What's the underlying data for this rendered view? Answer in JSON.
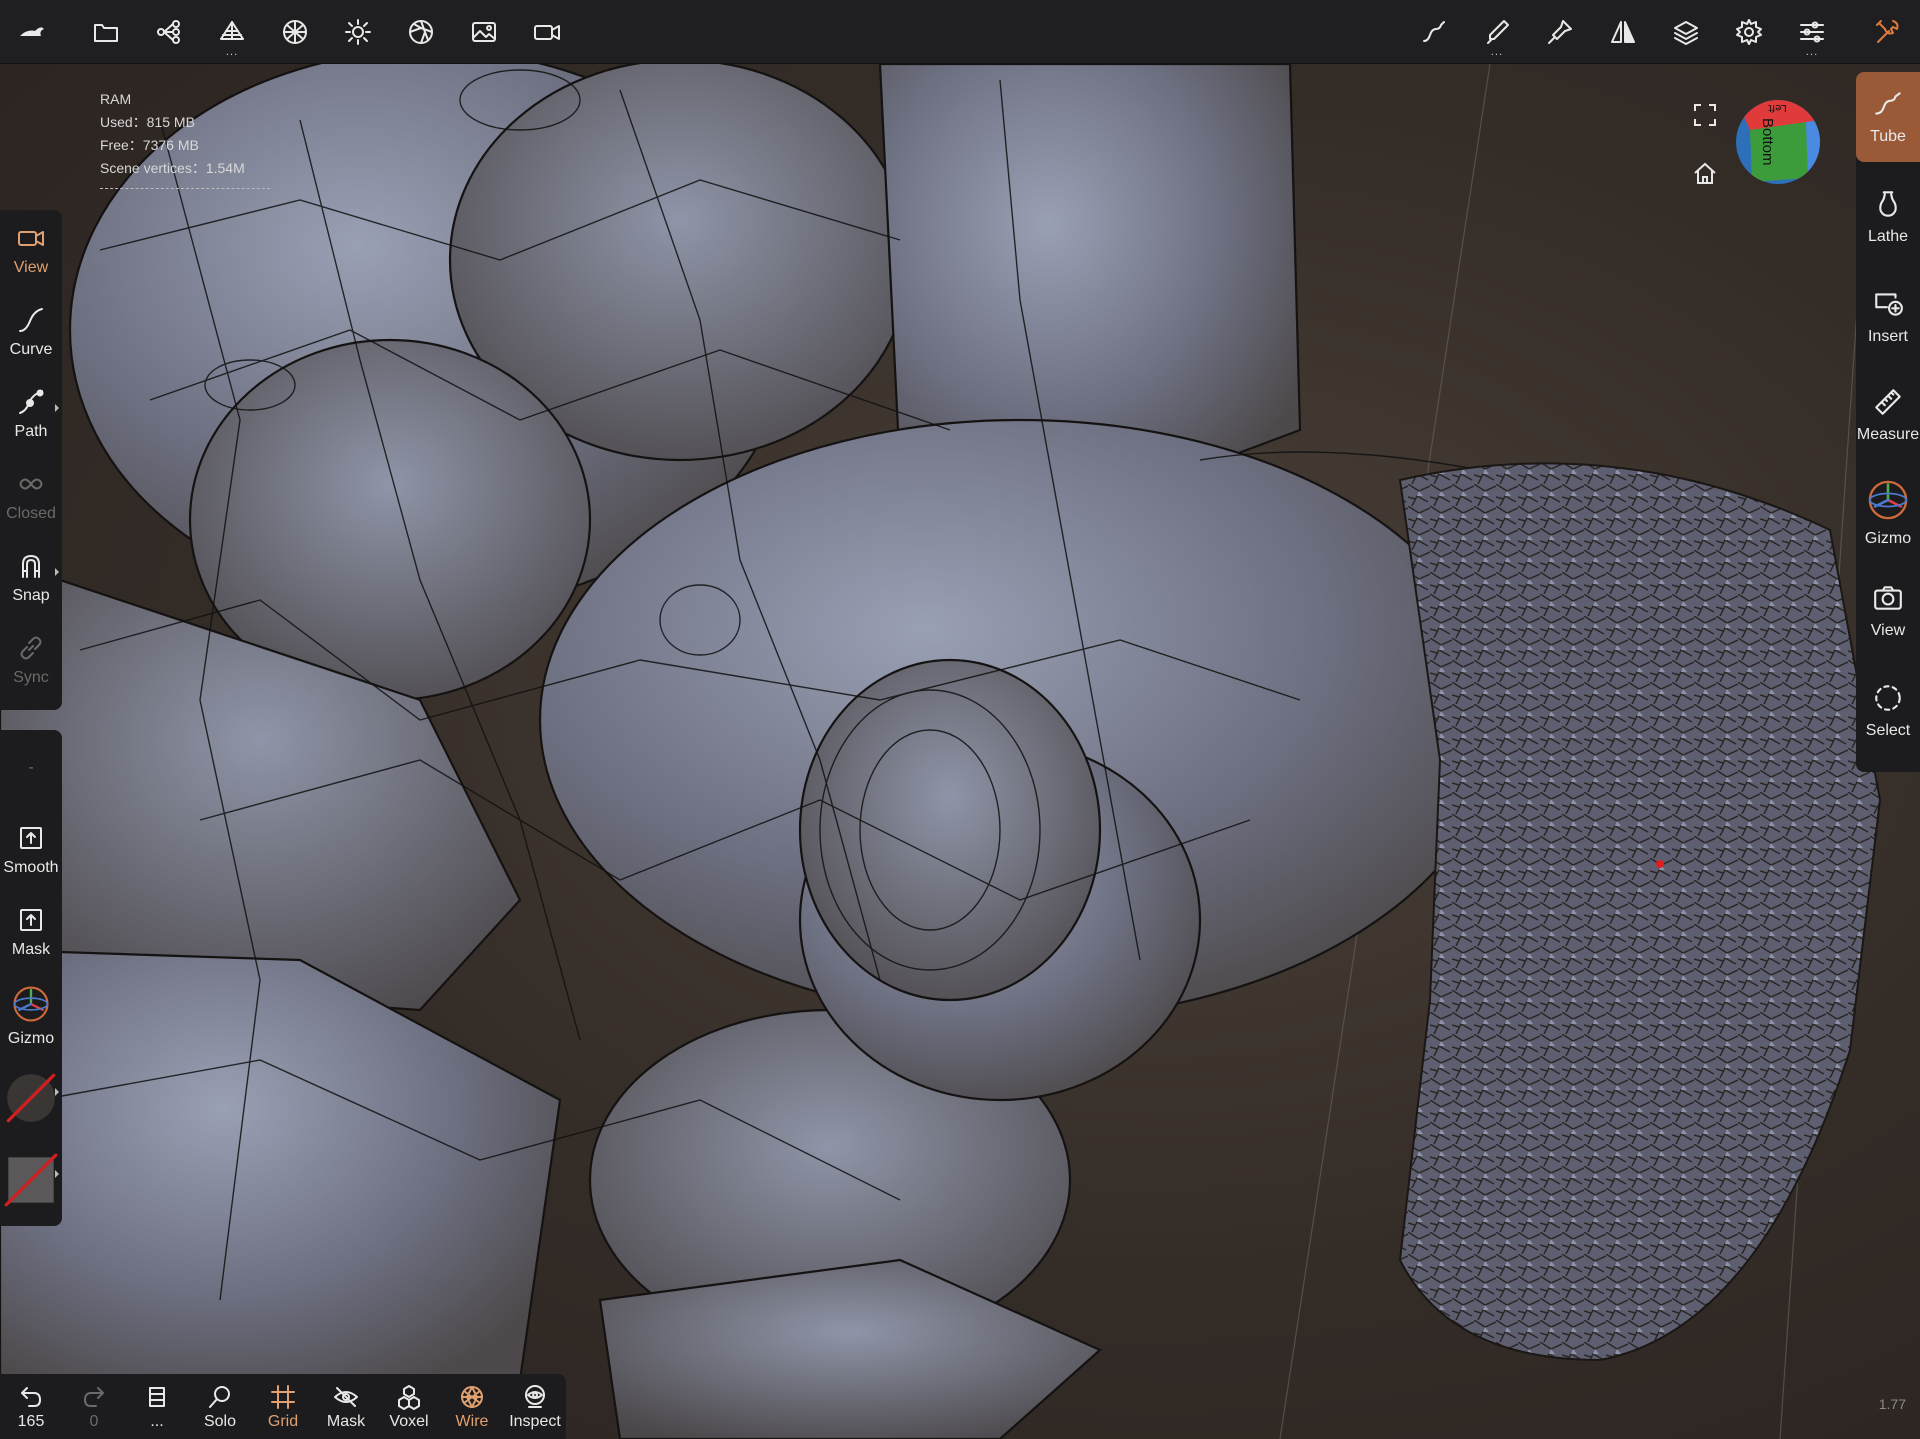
{
  "topbar": {
    "left_icons": [
      "app-logo-icon",
      "folder-icon",
      "scene-tree-icon",
      "primitives-icon",
      "topology-icon",
      "lighting-icon",
      "shading-icon",
      "background-image-icon",
      "camera-icon"
    ],
    "right_icons": [
      "stroke-icon",
      "brush-icon",
      "painting-icon",
      "symmetry-icon",
      "layers-icon",
      "settings-icon",
      "sliders-icon",
      "tools-icon"
    ]
  },
  "ram": {
    "title": "RAM",
    "used": "Used：815 MB",
    "free": "Free：7376 MB",
    "vertices": "Scene vertices：1.54M"
  },
  "left_toolbar": {
    "view": "View",
    "curve": "Curve",
    "path": "Path",
    "closed": "Closed",
    "snap": "Snap",
    "sync": "Sync",
    "dash": "-",
    "smooth": "Smooth",
    "mask": "Mask",
    "gizmo": "Gizmo"
  },
  "right_toolbar": {
    "tube": "Tube",
    "lathe": "Lathe",
    "insert": "Insert",
    "measure": "Measure",
    "gizmo": "Gizmo",
    "view": "View",
    "select": "Select"
  },
  "navcube": {
    "face": "Bottom",
    "top_face": "Left"
  },
  "bottom_toolbar": {
    "undo_count": "165",
    "redo_count": "0",
    "layers_dots": "...",
    "solo": "Solo",
    "grid": "Grid",
    "mask": "Mask",
    "voxel": "Voxel",
    "wire": "Wire",
    "inspect": "Inspect"
  },
  "corner_value": "1.77",
  "colors": {
    "accent": "#e0a070",
    "panel": "#1c1c1e",
    "active_tool": "#9a5a38"
  }
}
